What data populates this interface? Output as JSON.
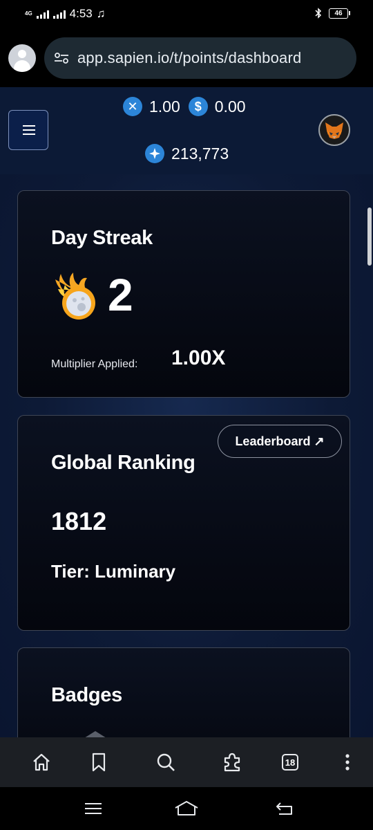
{
  "status_bar": {
    "network": "4G",
    "time": "4:53",
    "battery": "46",
    "icons": [
      "signal-icon",
      "music-note-icon",
      "bluetooth-icon",
      "battery-icon"
    ]
  },
  "browser": {
    "url": "app.sapien.io/t/points/dashboard",
    "tab_count": "18",
    "icons": [
      "profile-icon",
      "site-settings-icon",
      "home-icon",
      "bookmark-icon",
      "search-icon",
      "extensions-icon",
      "tabs-icon",
      "more-options-icon"
    ]
  },
  "header": {
    "balances": [
      {
        "icon": "x-coin-icon",
        "symbol": "✕",
        "value": "1.00"
      },
      {
        "icon": "dollar-coin-icon",
        "symbol": "$",
        "value": "0.00"
      }
    ],
    "points": {
      "icon": "points-star-icon",
      "value": "213,773"
    },
    "icons": [
      "menu-icon",
      "metamask-fox-icon"
    ]
  },
  "streak_card": {
    "title": "Day Streak",
    "icon": "flaming-comet-icon",
    "count": "2",
    "multiplier_label": "Multiplier Applied:",
    "multiplier_value": "1.00X"
  },
  "ranking_card": {
    "title": "Global Ranking",
    "leaderboard_label": "Leaderboard ↗",
    "rank": "1812",
    "tier": "Tier: Luminary"
  },
  "badges_card": {
    "title": "Badges"
  },
  "colors": {
    "header_bg": "#0c1a36",
    "coin_blue": "#2c85d8",
    "card_border": "#3f4655",
    "url_bar_bg": "#1e2a33"
  }
}
